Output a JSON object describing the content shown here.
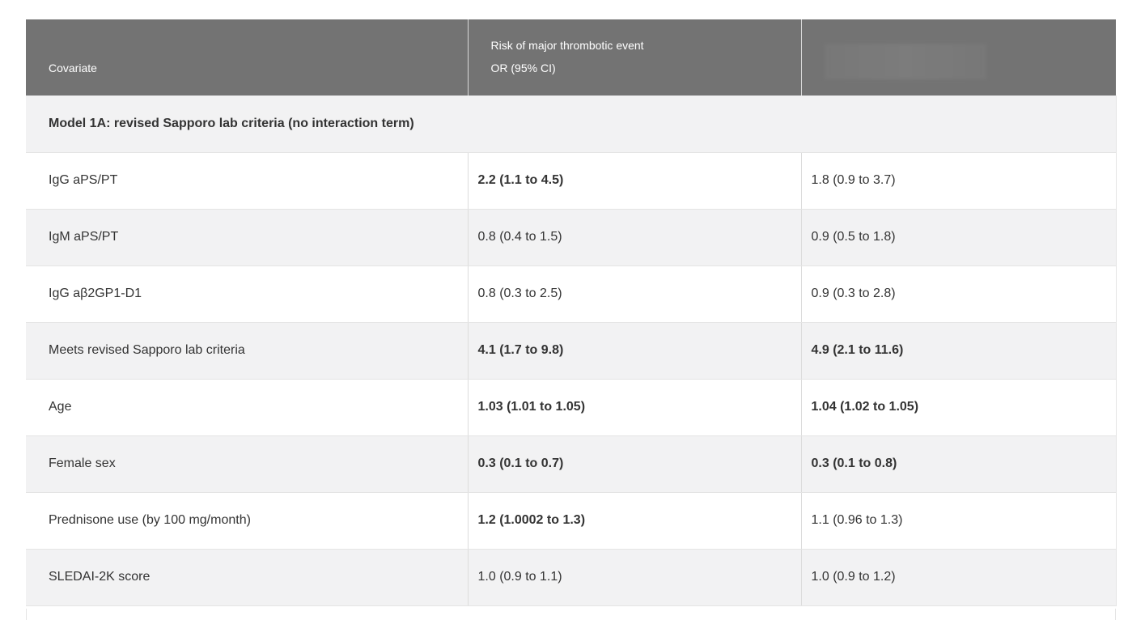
{
  "table": {
    "headers": {
      "covariate": "Covariate",
      "risk_line1": "Risk of major thrombotic event",
      "risk_line2": "OR (95% CI)"
    },
    "section_title": "Model 1A: revised Sapporo lab criteria (no interaction term)",
    "rows": [
      {
        "covariate": "IgG aPS/PT",
        "col2": "2.2 (1.1 to 4.5)",
        "col2_bold": true,
        "col3": "1.8 (0.9 to 3.7)",
        "col3_bold": false
      },
      {
        "covariate": "IgM aPS/PT",
        "col2": "0.8 (0.4 to 1.5)",
        "col2_bold": false,
        "col3": "0.9 (0.5 to 1.8)",
        "col3_bold": false
      },
      {
        "covariate": "IgG aβ2GP1-D1",
        "col2": "0.8 (0.3 to 2.5)",
        "col2_bold": false,
        "col3": "0.9 (0.3 to 2.8)",
        "col3_bold": false
      },
      {
        "covariate": "Meets revised Sapporo lab criteria",
        "col2": "4.1 (1.7 to 9.8)",
        "col2_bold": true,
        "col3": "4.9 (2.1 to 11.6)",
        "col3_bold": true
      },
      {
        "covariate": "Age",
        "col2": "1.03 (1.01 to 1.05)",
        "col2_bold": true,
        "col3": "1.04 (1.02 to 1.05)",
        "col3_bold": true
      },
      {
        "covariate": "Female sex",
        "col2": "0.3 (0.1 to 0.7)",
        "col2_bold": true,
        "col3": "0.3 (0.1 to 0.8)",
        "col3_bold": true
      },
      {
        "covariate": "Prednisone use (by 100 mg/month)",
        "col2": "1.2 (1.0002 to 1.3)",
        "col2_bold": true,
        "col3": "1.1 (0.96 to 1.3)",
        "col3_bold": false
      },
      {
        "covariate": "SLEDAI-2K score",
        "col2": "1.0 (0.9 to 1.1)",
        "col2_bold": false,
        "col3": "1.0 (0.9 to 1.2)",
        "col3_bold": false
      }
    ]
  },
  "colors": {
    "header_bg": "#737373",
    "shaded_row": "#f2f2f3",
    "text": "#333333"
  }
}
